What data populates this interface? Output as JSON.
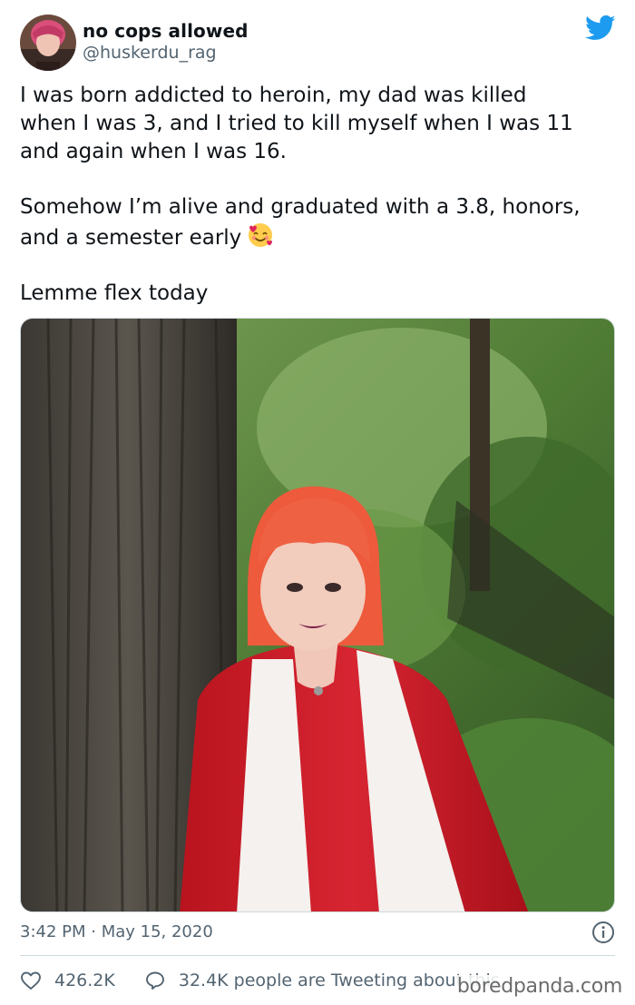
{
  "author": {
    "display_name": "no cops allowed",
    "handle": "@huskerdu_rag"
  },
  "tweet": {
    "lines": [
      "I was born addicted to heroin, my dad was killed",
      "when I was 3, and I tried to kill myself when I was 11",
      "and again when I was 16.",
      "Somehow I’m alive and graduated with a 3.8, honors,",
      "and a semester early",
      "Lemme flex today"
    ]
  },
  "meta": {
    "timestamp": "3:42 PM · May 15, 2020"
  },
  "actions": {
    "likes": "426.2K",
    "tweeting": "32.4K people are Tweeting about this"
  },
  "watermark": "boredpanda.com",
  "colors": {
    "twitter_blue": "#1d9bf0",
    "text_primary": "#0f1419",
    "text_secondary": "#536471",
    "divider": "#cfd9de"
  },
  "icons": [
    "twitter-bird-icon",
    "info-icon",
    "heart-icon",
    "speech-bubble-icon",
    "smiling-face-with-hearts-emoji"
  ]
}
